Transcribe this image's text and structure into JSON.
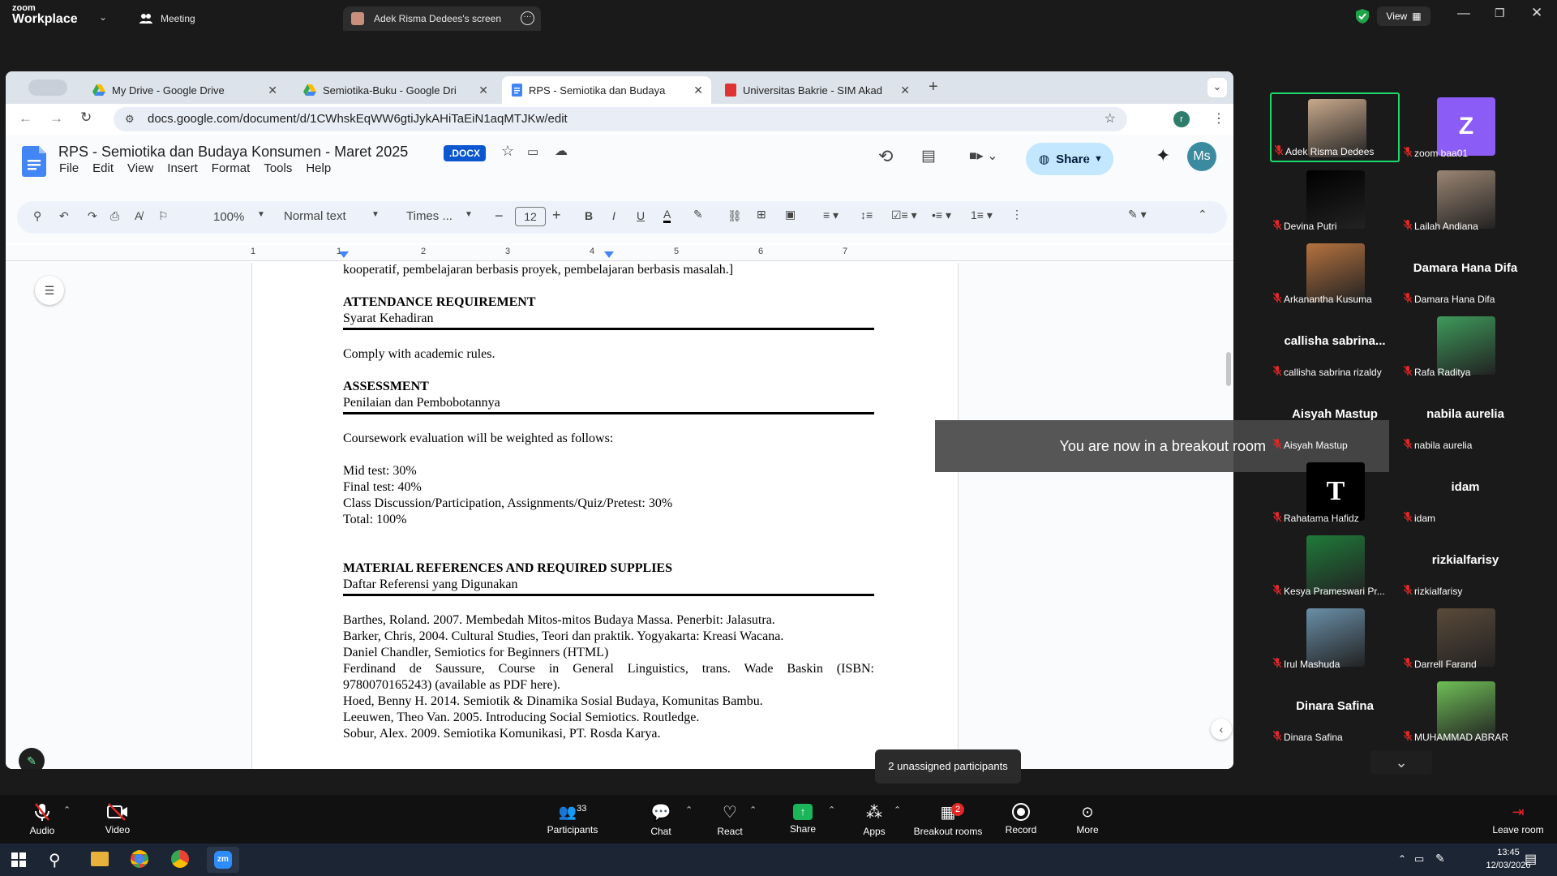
{
  "zoom_top": {
    "logo_small": "zoom",
    "logo_big": "Workplace",
    "meeting_tab": "Meeting",
    "screen_tab": "Adek Risma Dedees's screen",
    "view_label": "View"
  },
  "chrome": {
    "tabs": [
      {
        "label": "My Drive - Google Drive"
      },
      {
        "label": "Semiotika-Buku - Google Dri"
      },
      {
        "label": "RPS - Semiotika dan Budaya"
      },
      {
        "label": "Universitas Bakrie - SIM Akad"
      }
    ],
    "url": "docs.google.com/document/d/1CWhskEqWW6gtiJykAHiTaEiN1aqMTJKw/edit",
    "profile_initial": "r"
  },
  "docs": {
    "title": "RPS - Semiotika dan Budaya Konsumen - Maret 2025",
    "badge": ".DOCX",
    "menu": [
      "File",
      "Edit",
      "View",
      "Insert",
      "Format",
      "Tools",
      "Help"
    ],
    "share_label": "Share",
    "avatar": "Ms",
    "toolbar": {
      "zoom": "100%",
      "style": "Normal text",
      "font": "Times ...",
      "font_size": "12"
    },
    "ruler_numbers": [
      "1",
      "1",
      "2",
      "3",
      "4",
      "5",
      "6",
      "7"
    ]
  },
  "document": {
    "lines": [
      {
        "text": "kooperatif, pembelajaran berbasis proyek, pembelajaran berbasis masalah.]",
        "bold": false
      },
      {
        "text": "ATTENDANCE REQUIREMENT",
        "bold": true
      },
      {
        "text": "Syarat Kehadiran",
        "bold": false
      },
      {
        "text": "Comply with academic rules.",
        "bold": false
      },
      {
        "text": "ASSESSMENT",
        "bold": true
      },
      {
        "text": "Penilaian dan Pembobotannya",
        "bold": false
      },
      {
        "text": "Coursework evaluation will be weighted as follows:",
        "bold": false
      },
      {
        "text": "Mid test: 30%",
        "bold": false
      },
      {
        "text": "Final test: 40%",
        "bold": false
      },
      {
        "text": "Class Discussion/Participation, Assignments/Quiz/Pretest: 30%",
        "bold": false
      },
      {
        "text": "Total: 100%",
        "bold": false
      },
      {
        "text": "MATERIAL REFERENCES AND REQUIRED SUPPLIES",
        "bold": true
      },
      {
        "text": "Daftar Referensi yang Digunakan",
        "bold": false
      },
      {
        "text": "Barthes, Roland. 2007. Membedah Mitos-mitos Budaya Massa. Penerbit: Jalasutra.",
        "bold": false
      },
      {
        "text": "Barker, Chris, 2004. Cultural Studies, Teori dan praktik. Yogyakarta: Kreasi Wacana.",
        "bold": false
      },
      {
        "text": "Daniel Chandler, Semiotics for Beginners (HTML)",
        "bold": false
      },
      {
        "text": "Ferdinand de Saussure, Course in General Linguistics, trans. Wade Baskin (ISBN:",
        "bold": false
      },
      {
        "text": "9780070165243) (available as PDF here).",
        "bold": false
      },
      {
        "text": "Hoed, Benny H. 2014. Semiotik & Dinamika Sosial Budaya, Komunitas Bambu.",
        "bold": false
      },
      {
        "text": "Leeuwen, Theo Van. 2005. Introducing Social Semiotics. Routledge.",
        "bold": false
      },
      {
        "text": "Sobur, Alex. 2009. Semiotika Komunikasi, PT. Rosda Karya.",
        "bold": false
      }
    ]
  },
  "notifications": {
    "breakout": "You are now in a breakout room",
    "unassigned": "2 unassigned participants"
  },
  "participants": [
    {
      "name": "Adek Risma Dedees",
      "big": "",
      "avatar": "photo",
      "color": "#c9a98c"
    },
    {
      "name": "zoom baa01",
      "big": "",
      "avatar": "Z",
      "color": "#8b5cf6"
    },
    {
      "name": "Devina Putri",
      "big": "",
      "avatar": "black",
      "color": "#000000"
    },
    {
      "name": "Lailah Andiana",
      "big": "",
      "avatar": "photo",
      "color": "#9b8573"
    },
    {
      "name": "Arkanantha Kusuma",
      "big": "",
      "avatar": "photo",
      "color": "#b5723f"
    },
    {
      "name": "Damara Hana Difa",
      "big": "Damara Hana Difa",
      "avatar": "",
      "color": ""
    },
    {
      "name": "callisha sabrina rizaldy",
      "big": "callisha  sabrina...",
      "avatar": "",
      "color": ""
    },
    {
      "name": "Rafa Raditya",
      "big": "",
      "avatar": "photo",
      "color": "#3e9a5b"
    },
    {
      "name": "Aisyah Mastup",
      "big": "Aisyah Mastup",
      "avatar": "",
      "color": ""
    },
    {
      "name": "nabila aurelia",
      "big": "nabila aurelia",
      "avatar": "",
      "color": ""
    },
    {
      "name": "Rahatama Hafidz",
      "big": "",
      "avatar": "T",
      "color": "#000000"
    },
    {
      "name": "idam",
      "big": "idam",
      "avatar": "",
      "color": ""
    },
    {
      "name": "Kesya Prameswari Pr...",
      "big": "",
      "avatar": "photo",
      "color": "#1f7a3a"
    },
    {
      "name": "rizkialfarisy",
      "big": "rizkialfarisy",
      "avatar": "",
      "color": ""
    },
    {
      "name": "Irul Mashuda",
      "big": "",
      "avatar": "photo",
      "color": "#6a8fa8"
    },
    {
      "name": "Darrell Farand",
      "big": "",
      "avatar": "photo",
      "color": "#5a4a3a"
    },
    {
      "name": "Dinara Safina",
      "big": "Dinara Safina",
      "avatar": "",
      "color": ""
    },
    {
      "name": "MUHAMMAD ABRAR",
      "big": "",
      "avatar": "photo",
      "color": "#6fbf57"
    }
  ],
  "toolbar": {
    "audio": "Audio",
    "video": "Video",
    "participants": "Participants",
    "participants_count": "33",
    "chat": "Chat",
    "react": "React",
    "share": "Share",
    "apps": "Apps",
    "breakout": "Breakout rooms",
    "breakout_badge": "2",
    "record": "Record",
    "more": "More",
    "leave": "Leave room"
  },
  "taskbar": {
    "time": "13:45",
    "date": "12/03/2026"
  }
}
